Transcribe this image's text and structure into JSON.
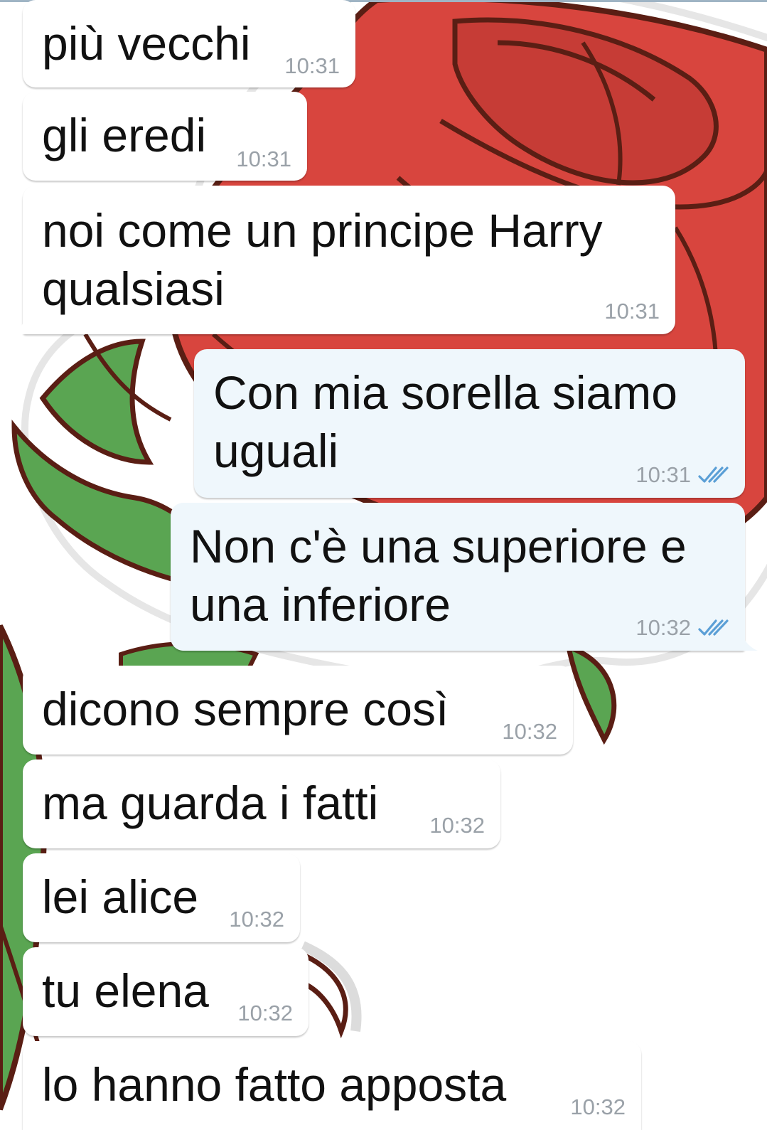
{
  "messages": [
    {
      "dir": "in",
      "lines": [
        "più vecchi"
      ],
      "time": "10:31"
    },
    {
      "dir": "in",
      "lines": [
        "gli eredi"
      ],
      "time": "10:31"
    },
    {
      "dir": "in",
      "lines": [
        "noi come un principe Harry",
        "qualsiasi"
      ],
      "time": "10:31"
    },
    {
      "dir": "out",
      "lines": [
        "Con mia sorella siamo",
        "uguali"
      ],
      "time": "10:31",
      "status": "read"
    },
    {
      "dir": "out",
      "lines": [
        "Non c'è una superiore e",
        "una inferiore"
      ],
      "time": "10:32",
      "status": "read"
    },
    {
      "dir": "in",
      "lines": [
        "dicono sempre così"
      ],
      "time": "10:32"
    },
    {
      "dir": "in",
      "lines": [
        "ma guarda i fatti"
      ],
      "time": "10:32"
    },
    {
      "dir": "in",
      "lines": [
        "lei alice"
      ],
      "time": "10:32"
    },
    {
      "dir": "in",
      "lines": [
        "tu elena"
      ],
      "time": "10:32"
    },
    {
      "dir": "in",
      "lines": [
        "lo hanno fatto apposta"
      ],
      "time": "10:32"
    }
  ],
  "colors": {
    "incoming_bubble": "#ffffff",
    "outgoing_bubble": "#eff7fc",
    "time_text": "#9aa1a8",
    "read_ticks": "#5b9fd6",
    "wallpaper_rose": "#d9463f",
    "wallpaper_leaf": "#5aa552",
    "wallpaper_outline": "#5a1e14"
  },
  "icons": {
    "read_status": "double-check-icon",
    "wallpaper": "rose-sticker-wallpaper"
  }
}
